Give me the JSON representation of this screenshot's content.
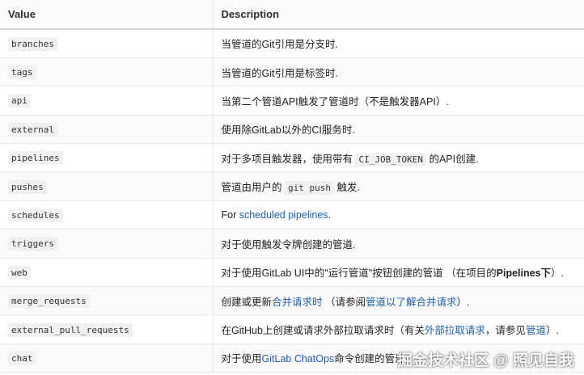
{
  "table": {
    "headers": [
      "Value",
      "Description"
    ],
    "rows": {
      "branches": {
        "value": "branches",
        "desc": "当管道的Git引用是分支时."
      },
      "tags": {
        "value": "tags",
        "desc": "当管道的Git引用是标签时."
      },
      "api": {
        "value": "api",
        "desc": "当第二个管道API触发了管道时（不是触发器API）."
      },
      "external": {
        "value": "external",
        "desc": "使用除GitLab以外的CI服务时."
      },
      "pipelines": {
        "value": "pipelines",
        "desc_pre": "对于多项目触发器，使用带有 ",
        "code": "CI_JOB_TOKEN",
        "desc_post": " 的API创建."
      },
      "pushes": {
        "value": "pushes",
        "desc_pre": "管道由用户的 ",
        "code": "git push",
        "desc_post": " 触发."
      },
      "schedules": {
        "value": "schedules",
        "desc_pre": "For ",
        "link": "scheduled pipelines",
        "desc_post": "."
      },
      "triggers": {
        "value": "triggers",
        "desc": "对于使用触发令牌创建的管道."
      },
      "web": {
        "value": "web",
        "desc_pre": "对于使用GitLab UI中的\"运行管道\"按钮创建的管道 （在项目的",
        "bold": "Pipelines下",
        "desc_post": "）."
      },
      "merge_requests": {
        "value": "merge_requests",
        "desc_pre": "创建或更新",
        "link1": "合并请求时",
        "desc_mid": " （请参阅",
        "link2": "管道以了解合并请求",
        "desc_post": "）."
      },
      "external_pull_requests": {
        "value": "external_pull_requests",
        "desc_pre": "在GitHub上创建或请求外部拉取请求时（有关",
        "link1": "外部拉取请求",
        "desc_mid": "，请参见",
        "link2": "管道",
        "desc_post": "）."
      },
      "chat": {
        "value": "chat",
        "desc_pre": "对于使用",
        "link": "GitLab ChatOps",
        "desc_post": "命令创建的管道."
      }
    }
  },
  "watermark": "掘金技术社区 @ 照见自我"
}
